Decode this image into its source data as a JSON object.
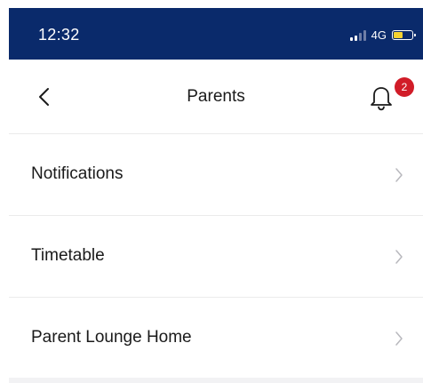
{
  "status_bar": {
    "time": "12:32",
    "network": "4G",
    "battery_level": 0.55,
    "signal_bars_active": 2,
    "background_color": "#0a2a6b",
    "battery_color": "#f6d230"
  },
  "header": {
    "title": "Parents",
    "back_icon": "chevron-left-icon",
    "bell_icon": "bell-icon",
    "notification_count": "2",
    "badge_color": "#d11c28"
  },
  "menu": {
    "items": [
      {
        "label": "Notifications",
        "icon": "chevron-right-icon"
      },
      {
        "label": "Timetable",
        "icon": "chevron-right-icon"
      },
      {
        "label": "Parent Lounge Home",
        "icon": "chevron-right-icon"
      }
    ]
  }
}
